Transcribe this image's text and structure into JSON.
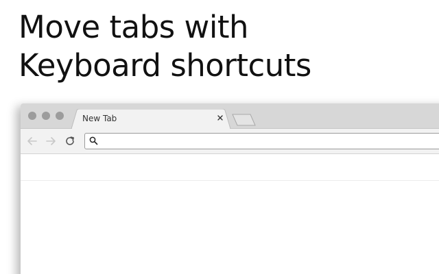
{
  "headline": {
    "line1": "Move tabs with",
    "line2": "Keyboard shortcuts"
  },
  "browser": {
    "window_controls": [
      "close",
      "minimize",
      "zoom"
    ],
    "tabs": [
      {
        "title": "New Tab",
        "active": true,
        "close_icon": "close-icon"
      }
    ],
    "new_tab_icon": "new-tab-icon",
    "toolbar": {
      "back_icon": "arrow-left-icon",
      "forward_icon": "arrow-right-icon",
      "reload_icon": "reload-icon",
      "omnibox": {
        "value": "",
        "placeholder": "",
        "icon": "search-icon"
      }
    }
  },
  "colors": {
    "titlebar": "#d7d7d7",
    "toolbar": "#f2f2f2",
    "window_dot": "#9c9c9c",
    "nav_disabled": "#c8c8c8",
    "text": "#111111"
  }
}
